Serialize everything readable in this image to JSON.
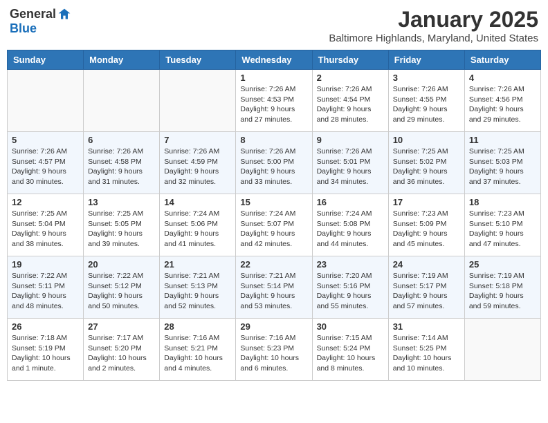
{
  "header": {
    "logo_general": "General",
    "logo_blue": "Blue",
    "month": "January 2025",
    "location": "Baltimore Highlands, Maryland, United States"
  },
  "days_of_week": [
    "Sunday",
    "Monday",
    "Tuesday",
    "Wednesday",
    "Thursday",
    "Friday",
    "Saturday"
  ],
  "weeks": [
    [
      {
        "day": "",
        "info": ""
      },
      {
        "day": "",
        "info": ""
      },
      {
        "day": "",
        "info": ""
      },
      {
        "day": "1",
        "info": "Sunrise: 7:26 AM\nSunset: 4:53 PM\nDaylight: 9 hours\nand 27 minutes."
      },
      {
        "day": "2",
        "info": "Sunrise: 7:26 AM\nSunset: 4:54 PM\nDaylight: 9 hours\nand 28 minutes."
      },
      {
        "day": "3",
        "info": "Sunrise: 7:26 AM\nSunset: 4:55 PM\nDaylight: 9 hours\nand 29 minutes."
      },
      {
        "day": "4",
        "info": "Sunrise: 7:26 AM\nSunset: 4:56 PM\nDaylight: 9 hours\nand 29 minutes."
      }
    ],
    [
      {
        "day": "5",
        "info": "Sunrise: 7:26 AM\nSunset: 4:57 PM\nDaylight: 9 hours\nand 30 minutes."
      },
      {
        "day": "6",
        "info": "Sunrise: 7:26 AM\nSunset: 4:58 PM\nDaylight: 9 hours\nand 31 minutes."
      },
      {
        "day": "7",
        "info": "Sunrise: 7:26 AM\nSunset: 4:59 PM\nDaylight: 9 hours\nand 32 minutes."
      },
      {
        "day": "8",
        "info": "Sunrise: 7:26 AM\nSunset: 5:00 PM\nDaylight: 9 hours\nand 33 minutes."
      },
      {
        "day": "9",
        "info": "Sunrise: 7:26 AM\nSunset: 5:01 PM\nDaylight: 9 hours\nand 34 minutes."
      },
      {
        "day": "10",
        "info": "Sunrise: 7:25 AM\nSunset: 5:02 PM\nDaylight: 9 hours\nand 36 minutes."
      },
      {
        "day": "11",
        "info": "Sunrise: 7:25 AM\nSunset: 5:03 PM\nDaylight: 9 hours\nand 37 minutes."
      }
    ],
    [
      {
        "day": "12",
        "info": "Sunrise: 7:25 AM\nSunset: 5:04 PM\nDaylight: 9 hours\nand 38 minutes."
      },
      {
        "day": "13",
        "info": "Sunrise: 7:25 AM\nSunset: 5:05 PM\nDaylight: 9 hours\nand 39 minutes."
      },
      {
        "day": "14",
        "info": "Sunrise: 7:24 AM\nSunset: 5:06 PM\nDaylight: 9 hours\nand 41 minutes."
      },
      {
        "day": "15",
        "info": "Sunrise: 7:24 AM\nSunset: 5:07 PM\nDaylight: 9 hours\nand 42 minutes."
      },
      {
        "day": "16",
        "info": "Sunrise: 7:24 AM\nSunset: 5:08 PM\nDaylight: 9 hours\nand 44 minutes."
      },
      {
        "day": "17",
        "info": "Sunrise: 7:23 AM\nSunset: 5:09 PM\nDaylight: 9 hours\nand 45 minutes."
      },
      {
        "day": "18",
        "info": "Sunrise: 7:23 AM\nSunset: 5:10 PM\nDaylight: 9 hours\nand 47 minutes."
      }
    ],
    [
      {
        "day": "19",
        "info": "Sunrise: 7:22 AM\nSunset: 5:11 PM\nDaylight: 9 hours\nand 48 minutes."
      },
      {
        "day": "20",
        "info": "Sunrise: 7:22 AM\nSunset: 5:12 PM\nDaylight: 9 hours\nand 50 minutes."
      },
      {
        "day": "21",
        "info": "Sunrise: 7:21 AM\nSunset: 5:13 PM\nDaylight: 9 hours\nand 52 minutes."
      },
      {
        "day": "22",
        "info": "Sunrise: 7:21 AM\nSunset: 5:14 PM\nDaylight: 9 hours\nand 53 minutes."
      },
      {
        "day": "23",
        "info": "Sunrise: 7:20 AM\nSunset: 5:16 PM\nDaylight: 9 hours\nand 55 minutes."
      },
      {
        "day": "24",
        "info": "Sunrise: 7:19 AM\nSunset: 5:17 PM\nDaylight: 9 hours\nand 57 minutes."
      },
      {
        "day": "25",
        "info": "Sunrise: 7:19 AM\nSunset: 5:18 PM\nDaylight: 9 hours\nand 59 minutes."
      }
    ],
    [
      {
        "day": "26",
        "info": "Sunrise: 7:18 AM\nSunset: 5:19 PM\nDaylight: 10 hours\nand 1 minute."
      },
      {
        "day": "27",
        "info": "Sunrise: 7:17 AM\nSunset: 5:20 PM\nDaylight: 10 hours\nand 2 minutes."
      },
      {
        "day": "28",
        "info": "Sunrise: 7:16 AM\nSunset: 5:21 PM\nDaylight: 10 hours\nand 4 minutes."
      },
      {
        "day": "29",
        "info": "Sunrise: 7:16 AM\nSunset: 5:23 PM\nDaylight: 10 hours\nand 6 minutes."
      },
      {
        "day": "30",
        "info": "Sunrise: 7:15 AM\nSunset: 5:24 PM\nDaylight: 10 hours\nand 8 minutes."
      },
      {
        "day": "31",
        "info": "Sunrise: 7:14 AM\nSunset: 5:25 PM\nDaylight: 10 hours\nand 10 minutes."
      },
      {
        "day": "",
        "info": ""
      }
    ]
  ]
}
